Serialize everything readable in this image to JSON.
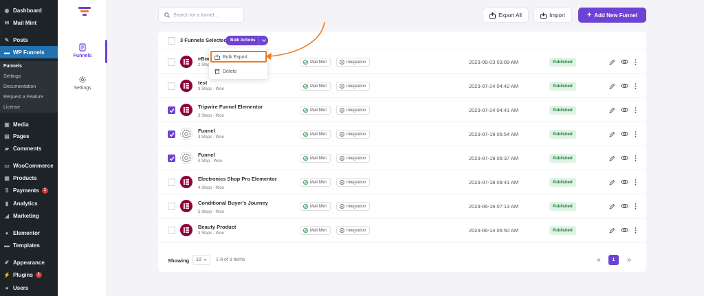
{
  "wp_menu": {
    "dashboard": "Dashboard",
    "mail_mint": "Mail Mint",
    "posts": "Posts",
    "wp_funnels": "WP Funnels",
    "sub": [
      "Funnels",
      "Settings",
      "Documentation",
      "Request a Feature",
      "License"
    ],
    "media": "Media",
    "pages": "Pages",
    "comments": "Comments",
    "woocommerce": "WooCommerce",
    "products": "Products",
    "payments": "Payments",
    "payments_badge": "1",
    "analytics": "Analytics",
    "marketing": "Marketing",
    "elementor": "Elementor",
    "templates": "Templates",
    "appearance": "Appearance",
    "plugins": "Plugins",
    "plugins_badge": "1",
    "users": "Users"
  },
  "plugin_nav": {
    "funnels": "Funnels",
    "settings": "Settings"
  },
  "toolbar": {
    "search_placeholder": "Search for a funnel...",
    "export_all": "Export All",
    "import": "Import",
    "add_new": "Add New Funnel"
  },
  "bulk": {
    "selected": "3 Funnels Selected",
    "actions": "Bulk Actions",
    "bulk_export": "Bulk Export",
    "delete": "Delete"
  },
  "labels": {
    "mail_mint": "Mail Mint",
    "integration": "Integration"
  },
  "funnels": [
    {
      "name": "eBoc",
      "steps": "2 Step",
      "date": "2023-08-03 03:09 AM",
      "status": "Published",
      "checked": false,
      "icon": "elementor"
    },
    {
      "name": "test",
      "steps": "3 Steps - Woo",
      "date": "2023-07-24 04:42 AM",
      "status": "Published",
      "checked": false,
      "icon": "elementor"
    },
    {
      "name": "Tripwire Funnel Elementor",
      "steps": "3 Steps - Woo",
      "date": "2023-07-24 04:41 AM",
      "status": "Published",
      "checked": true,
      "icon": "elementor"
    },
    {
      "name": "Funnel",
      "steps": "3 Steps - Woo",
      "date": "2023-07-19 05:54 AM",
      "status": "Published",
      "checked": true,
      "icon": "gear"
    },
    {
      "name": "Funnel",
      "steps": "0 Step - Woo",
      "date": "2023-07-19 05:37 AM",
      "status": "Published",
      "checked": true,
      "icon": "gear"
    },
    {
      "name": "Electronics Shop Pro Elementor",
      "steps": "4 Steps - Woo",
      "date": "2023-07-18 09:41 AM",
      "status": "Published",
      "checked": false,
      "icon": "elementor"
    },
    {
      "name": "Conditional Buyer's Journey",
      "steps": "5 Steps - Woo",
      "date": "2023-06-16 07:13 AM",
      "status": "Published",
      "checked": false,
      "icon": "elementor"
    },
    {
      "name": "Beauty Product",
      "steps": "3 Steps - Woo",
      "date": "2023-06-14 05:50 AM",
      "status": "Published",
      "checked": false,
      "icon": "elementor"
    }
  ],
  "footer": {
    "showing": "Showing",
    "per_page": "10",
    "range": "1-8 of 8 items",
    "current_page": "1"
  },
  "colors": {
    "accent": "#6e42d3",
    "wp_sidebar": "#1d2327",
    "wp_active": "#2271b1",
    "highlight": "#f07a1a",
    "published_bg": "#dff3e4"
  }
}
